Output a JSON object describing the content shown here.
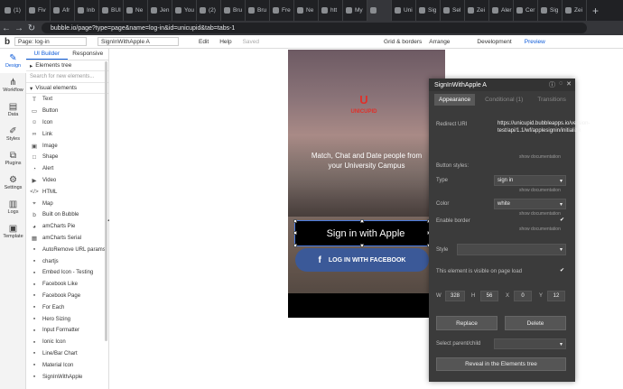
{
  "browser": {
    "tabs": [
      "(1)",
      "Fiv",
      "Afr",
      "Inb",
      "BUI",
      "Ne",
      "Jen",
      "You",
      "(2)",
      "Bru",
      "Bru",
      "Fre",
      "Ne",
      "htt",
      "My",
      "",
      "Uni",
      "Sig",
      "Sel",
      "Zei",
      "Aler",
      "Cer",
      "Sig",
      "Zei"
    ],
    "active_tab": 15,
    "new_tab": "+",
    "url": "bubble.io/page?type=page&name=log-in&id=unicupid&tab=tabs-1"
  },
  "bubble_bar": {
    "logo": "b",
    "page_select": "Page: log-in",
    "element_select": "SignInWithApple A",
    "menu": [
      "Edit",
      "Help",
      "Saved"
    ],
    "grid": "Grid & borders",
    "arrange": "Arrange",
    "env": "Development",
    "preview": "Preview"
  },
  "rail": [
    {
      "label": "Design",
      "icon": "design-icon"
    },
    {
      "label": "Workflow",
      "icon": "workflow-icon"
    },
    {
      "label": "Data",
      "icon": "data-icon"
    },
    {
      "label": "Styles",
      "icon": "styles-icon"
    },
    {
      "label": "Plugins",
      "icon": "plugins-icon"
    },
    {
      "label": "Settings",
      "icon": "settings-icon"
    },
    {
      "label": "Logs",
      "icon": "logs-icon"
    },
    {
      "label": "Template",
      "icon": "template-icon"
    }
  ],
  "panel": {
    "tabs": [
      "UI Builder",
      "Responsive"
    ],
    "elements_tree": "Elements tree",
    "search_placeholder": "Search for new elements...",
    "visual_elements": "Visual elements",
    "elements": [
      {
        "label": "Text",
        "icon": "T"
      },
      {
        "label": "Button",
        "icon": "▭"
      },
      {
        "label": "Icon",
        "icon": "☺"
      },
      {
        "label": "Link",
        "icon": "∞"
      },
      {
        "label": "Image",
        "icon": "▣"
      },
      {
        "label": "Shape",
        "icon": "□"
      },
      {
        "label": "Alert",
        "icon": "◔"
      },
      {
        "label": "Video",
        "icon": "▶"
      },
      {
        "label": "HTML",
        "icon": "</>"
      },
      {
        "label": "Map",
        "icon": "⌖"
      },
      {
        "label": "Built on Bubble",
        "icon": "b"
      },
      {
        "label": "amCharts Pie",
        "icon": "◕"
      },
      {
        "label": "amCharts Serial",
        "icon": "▦"
      },
      {
        "label": "AutoRemove URL params",
        "icon": "▪"
      },
      {
        "label": "chartjs",
        "icon": "▪"
      },
      {
        "label": "Embed Icon - Testing",
        "icon": "▪"
      },
      {
        "label": "Facebook Like",
        "icon": "▪"
      },
      {
        "label": "Facebook Page",
        "icon": "▪"
      },
      {
        "label": "For Each",
        "icon": "▪"
      },
      {
        "label": "Hero Sizing",
        "icon": "▪"
      },
      {
        "label": "Input Formatter",
        "icon": "▪"
      },
      {
        "label": "Ionic Icon",
        "icon": "▪"
      },
      {
        "label": "Line/Bar Chart",
        "icon": "▪"
      },
      {
        "label": "Material Icon",
        "icon": "▪"
      },
      {
        "label": "SignInWithApple",
        "icon": "▪"
      }
    ]
  },
  "canvas": {
    "logo_text": "UNICUPID",
    "logo_glyph": "U",
    "tagline": "Match, Chat and Date people from your University Campus",
    "apple_button": "Sign in with Apple",
    "apple_glyph": "",
    "facebook_button": "LOG IN WITH FACEBOOK",
    "facebook_glyph": "f"
  },
  "property_editor": {
    "title": "SignInWithApple A",
    "tabs": [
      "Appearance",
      "Conditional (1)",
      "Transitions"
    ],
    "redirect_label": "Redirect URI",
    "redirect_value": "https://unicupid.bubbleapps.io/version-test/api/1.1/wf/applesignin/initialize",
    "show_doc": "show documentation",
    "button_styles": "Button styles:",
    "type_label": "Type",
    "type_value": "sign in",
    "color_label": "Color",
    "color_value": "white",
    "border_label": "Enable border",
    "style_label": "Style",
    "visible_label": "This element is visible on page load",
    "w_label": "W",
    "w_value": "328",
    "h_label": "H",
    "h_value": "56",
    "x_label": "X",
    "x_value": "0",
    "y_label": "Y",
    "y_value": "12",
    "replace": "Replace",
    "delete": "Delete",
    "parent_label": "Select parent/child",
    "reveal": "Reveal in the Elements tree"
  }
}
